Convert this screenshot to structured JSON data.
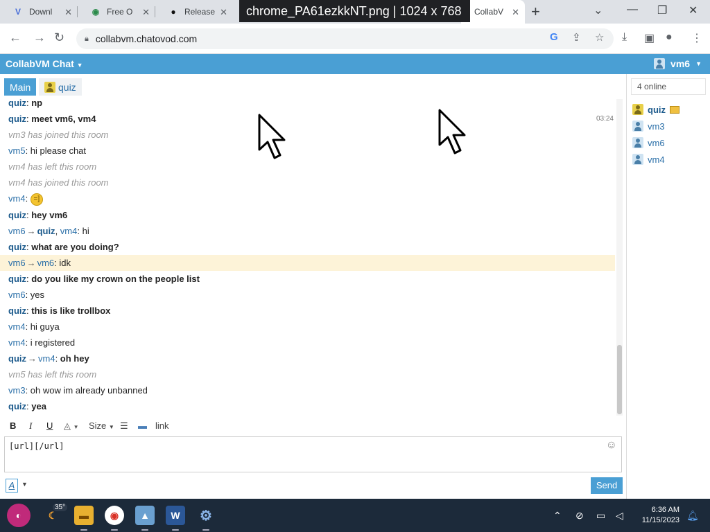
{
  "browser": {
    "tabs": [
      {
        "label": "Downl"
      },
      {
        "label": "Free O"
      },
      {
        "label": "Release"
      },
      {
        "label": "CollabV"
      }
    ],
    "image_overlay": "chrome_PA61ezkkNT.png  |  1024 x 768",
    "url": "collabvm.chatovod.com"
  },
  "chat": {
    "title": "CollabVM Chat",
    "current_user": "vm6",
    "rooms": [
      {
        "label": "Main",
        "active": true
      },
      {
        "label": "quiz",
        "active": false
      }
    ],
    "messages": [
      {
        "type": "msg",
        "user": "quiz",
        "text": "np",
        "bold": true
      },
      {
        "type": "msg",
        "user": "quiz",
        "text": "meet vm6, vm4",
        "bold": true,
        "time": "03:24"
      },
      {
        "type": "sys",
        "text": "vm3 has joined this room"
      },
      {
        "type": "msg",
        "user": "vm5",
        "text": "hi please chat"
      },
      {
        "type": "sys",
        "text": "vm4 has left this room"
      },
      {
        "type": "sys",
        "text": "vm4 has joined this room"
      },
      {
        "type": "emoji",
        "user": "vm4",
        "text": "=]"
      },
      {
        "type": "msg",
        "user": "quiz",
        "text": "hey vm6",
        "bold": true
      },
      {
        "type": "pm",
        "from": "vm6",
        "to": "quiz",
        "extra_to": "vm4",
        "text": "hi"
      },
      {
        "type": "msg",
        "user": "quiz",
        "text": "what are you doing?",
        "bold": true
      },
      {
        "type": "pm",
        "from": "vm6",
        "to": "vm6",
        "text": "idk",
        "highlight": true
      },
      {
        "type": "msg",
        "user": "quiz",
        "text": "do you like my crown on the people list",
        "bold": true
      },
      {
        "type": "msg",
        "user": "vm6",
        "text": "yes"
      },
      {
        "type": "msg",
        "user": "quiz",
        "text": "this is like trollbox",
        "bold": true
      },
      {
        "type": "msg",
        "user": "vm4",
        "text": "hi guya"
      },
      {
        "type": "msg",
        "user": "vm4",
        "text": "i registered"
      },
      {
        "type": "pm",
        "from": "quiz",
        "to": "vm4",
        "text": "oh hey",
        "bold": true
      },
      {
        "type": "sys",
        "text": "vm5 has left this room"
      },
      {
        "type": "msg",
        "user": "vm3",
        "text": "oh wow im already unbanned"
      },
      {
        "type": "msg",
        "user": "quiz",
        "text": "yea",
        "bold": true
      }
    ],
    "toolbar": {
      "bold": "B",
      "italic": "I",
      "underline": "U",
      "size": "Size",
      "link": "link"
    },
    "composer_text": "[url][/url]",
    "send_label": "Send",
    "font_label": "A",
    "online_count": "4 online",
    "people": [
      "quiz",
      "vm3",
      "vm6",
      "vm4"
    ]
  },
  "taskbar": {
    "temperature": "35°",
    "time": "6:36 AM",
    "date": "11/15/2023"
  },
  "colors": {
    "accent": "#4a9fd4",
    "highlight_row": "#fdf3d8"
  }
}
